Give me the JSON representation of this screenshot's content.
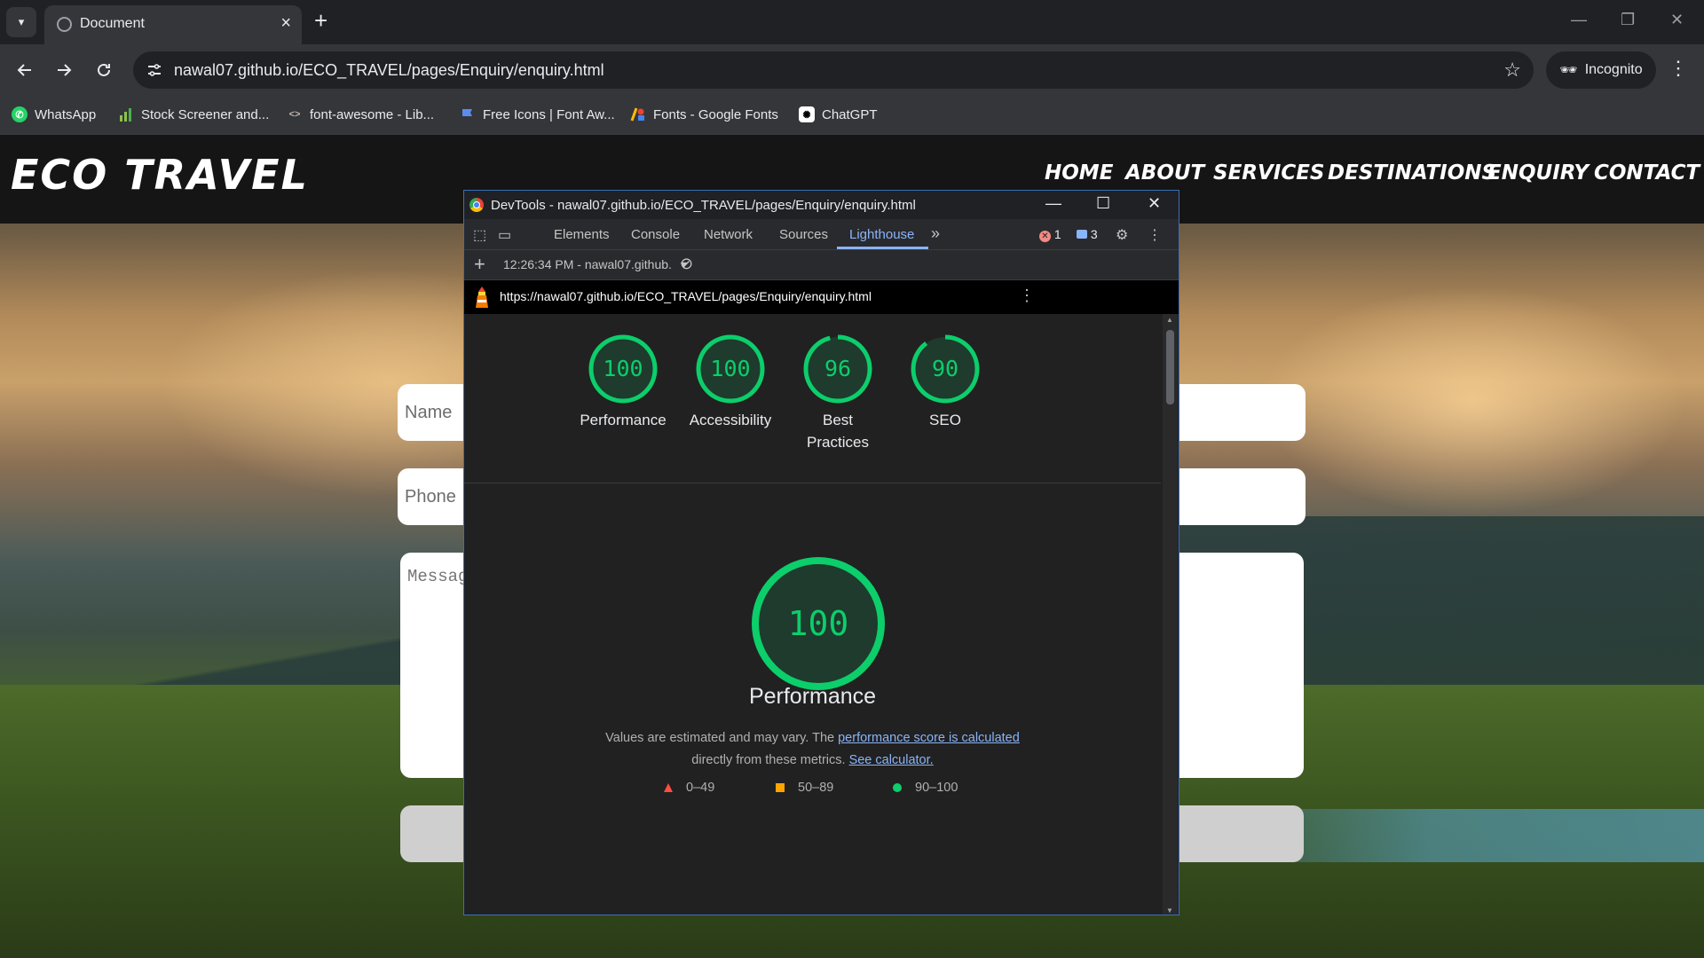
{
  "browser": {
    "tab_title": "Document",
    "url": "nawal07.github.io/ECO_TRAVEL/pages/Enquiry/enquiry.html",
    "incognito_label": "Incognito",
    "bookmarks": [
      {
        "label": "WhatsApp",
        "icon": "whatsapp-icon"
      },
      {
        "label": "Stock Screener and...",
        "icon": "bar-chart-icon"
      },
      {
        "label": "font-awesome - Lib...",
        "icon": "code-icon"
      },
      {
        "label": "Free Icons | Font Aw...",
        "icon": "flag-icon"
      },
      {
        "label": "Fonts - Google Fonts",
        "icon": "google-fonts-icon"
      },
      {
        "label": "ChatGPT",
        "icon": "chatgpt-icon"
      }
    ]
  },
  "site": {
    "logo": "ECO TRAVEL",
    "nav": [
      "HOME",
      "ABOUT",
      "SERVICES",
      "DESTINATIONS",
      "ENQUIRY",
      "CONTACT"
    ],
    "form": {
      "name_placeholder": "Name",
      "phone_placeholder": "Phone",
      "message_placeholder": "Messag"
    }
  },
  "devtools": {
    "window_title": "DevTools - nawal07.github.io/ECO_TRAVEL/pages/Enquiry/enquiry.html",
    "tabs": [
      "Elements",
      "Console",
      "Network",
      "Sources",
      "Lighthouse"
    ],
    "active_tab": "Lighthouse",
    "error_count": "1",
    "message_count": "3",
    "report_selector": "12:26:34 PM - nawal07.github.",
    "report_url": "https://nawal07.github.io/ECO_TRAVEL/pages/Enquiry/enquiry.html",
    "scores": [
      {
        "value": 100,
        "label": "Performance"
      },
      {
        "value": 100,
        "label": "Accessibility"
      },
      {
        "value": 96,
        "label": "Best Practices"
      },
      {
        "value": 90,
        "label": "SEO"
      }
    ],
    "main_score": 100,
    "main_title": "Performance",
    "desc_prefix": "Values are estimated and may vary. The ",
    "desc_link1": "performance score is calculated",
    "desc_middle": "directly from these metrics. ",
    "desc_link2": "See calculator.",
    "legend": [
      {
        "range": "0–49",
        "color": "#ff4e42",
        "shape": "triangle"
      },
      {
        "range": "50–89",
        "color": "#ffa400",
        "shape": "square"
      },
      {
        "range": "90–100",
        "color": "#0cce6b",
        "shape": "circle"
      }
    ],
    "pass_color": "#0cce6b"
  }
}
